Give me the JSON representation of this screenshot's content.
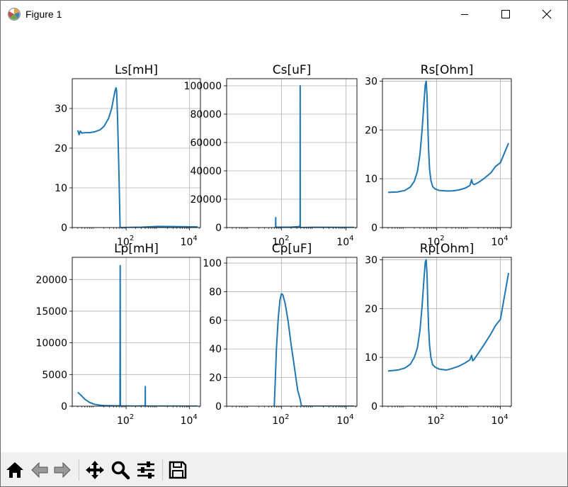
{
  "window": {
    "title": "Figure 1",
    "icons": [
      "app-icon",
      "minimize-icon",
      "maximize-icon",
      "close-icon"
    ]
  },
  "toolbar": {
    "buttons": [
      {
        "name": "home-button",
        "icon": "home-icon"
      },
      {
        "name": "back-button",
        "icon": "back-arrow-icon"
      },
      {
        "name": "forward-button",
        "icon": "forward-arrow-icon"
      },
      {
        "name": "pan-button",
        "icon": "pan-icon"
      },
      {
        "name": "zoom-button",
        "icon": "zoom-icon"
      },
      {
        "name": "subplots-button",
        "icon": "sliders-icon"
      },
      {
        "name": "save-button",
        "icon": "save-icon"
      }
    ]
  },
  "colors": {
    "line": "#1f77b4",
    "grid": "#b0b0b0",
    "toolbar_bg": "#f0f0f0"
  },
  "chart_data": [
    {
      "type": "line",
      "title": "Ls[mH]",
      "xscale": "log",
      "xlim": [
        2,
        22000
      ],
      "ylim": [
        0,
        37.5
      ],
      "yticks": [
        0,
        10,
        20,
        30
      ],
      "ytick_labels": [
        "0",
        "10",
        "20",
        "30"
      ],
      "xticks": [
        100,
        10000
      ],
      "xtick_labels": [
        "10^2",
        "10^4"
      ],
      "grid": true,
      "series": [
        {
          "x": [
            3,
            3.3,
            3.6,
            4,
            5,
            7,
            10,
            15,
            20,
            28,
            35,
            40,
            45,
            48,
            50,
            52,
            54,
            56,
            60,
            63,
            64.5,
            67,
            300,
            1000,
            3000,
            8000,
            18000
          ],
          "y": [
            24.5,
            23.4,
            24.3,
            23.8,
            23.9,
            23.9,
            24.1,
            24.6,
            25.5,
            27.5,
            30,
            32.5,
            34.5,
            35.2,
            34.5,
            31,
            27,
            22,
            12,
            4,
            0,
            0,
            0.1,
            0.3,
            0.25,
            0.2,
            0.15
          ]
        }
      ]
    },
    {
      "type": "line",
      "title": "Cs[uF]",
      "xscale": "log",
      "xlim": [
        2,
        22000
      ],
      "ylim": [
        0,
        105000
      ],
      "yticks": [
        0,
        20000,
        40000,
        60000,
        80000,
        100000
      ],
      "ytick_labels": [
        "0",
        "20000",
        "40000",
        "60000",
        "80000",
        "100000"
      ],
      "xticks": [
        100,
        10000
      ],
      "xtick_labels": [
        "10^2",
        "10^4"
      ],
      "grid": true,
      "series": [
        {
          "x": [
            66,
            66.5,
            67,
            68,
            100,
            200,
            350,
            380,
            382,
            384,
            1000,
            5000,
            18000
          ],
          "y": [
            0,
            7000,
            0,
            300,
            250,
            300,
            600,
            1500,
            100000,
            0,
            200,
            150,
            100
          ]
        }
      ]
    },
    {
      "type": "line",
      "title": "Rs[Ohm]",
      "xscale": "log",
      "xlim": [
        2,
        22000
      ],
      "ylim": [
        0,
        30.5
      ],
      "yticks": [
        0,
        10,
        20,
        30
      ],
      "ytick_labels": [
        "0",
        "10",
        "20",
        "30"
      ],
      "xticks": [
        100,
        10000
      ],
      "xtick_labels": [
        "10^2",
        "10^4"
      ],
      "grid": true,
      "series": [
        {
          "x": [
            3,
            6,
            10,
            15,
            20,
            25,
            30,
            35,
            40,
            44,
            47,
            50,
            53,
            56,
            60,
            66,
            75,
            90,
            120,
            200,
            300,
            500,
            800,
            1100,
            1250,
            1350,
            1500,
            2000,
            3000,
            5000,
            7000,
            10000,
            18000
          ],
          "y": [
            7.2,
            7.3,
            7.6,
            8.3,
            9.5,
            11.5,
            15,
            20,
            25.5,
            29.2,
            30,
            27,
            21,
            16,
            12,
            9.7,
            8.4,
            7.9,
            7.6,
            7.5,
            7.5,
            7.7,
            8.1,
            8.6,
            9.8,
            9,
            8.8,
            9.2,
            10,
            11.2,
            12.5,
            13.3,
            17.3
          ]
        }
      ]
    },
    {
      "type": "line",
      "title": "Lp[mH]",
      "xscale": "log",
      "xlim": [
        2,
        22000
      ],
      "ylim": [
        0,
        23500
      ],
      "yticks": [
        0,
        5000,
        10000,
        15000,
        20000
      ],
      "ytick_labels": [
        "0",
        "5000",
        "10000",
        "15000",
        "20000"
      ],
      "xticks": [
        100,
        10000
      ],
      "xtick_labels": [
        "10^2",
        "10^4"
      ],
      "grid": true,
      "series": [
        {
          "x": [
            3,
            4,
            5,
            7,
            10,
            15,
            20,
            30,
            50,
            64,
            65,
            66,
            70,
            200,
            400,
            402,
            404,
            1000,
            5000,
            18000
          ],
          "y": [
            2200,
            1600,
            1100,
            600,
            300,
            150,
            100,
            80,
            60,
            50,
            22200,
            0,
            40,
            20,
            50,
            3100,
            30,
            20,
            10,
            5
          ]
        }
      ]
    },
    {
      "type": "line",
      "title": "Cp[uF]",
      "xscale": "log",
      "xlim": [
        2,
        22000
      ],
      "ylim": [
        0,
        104
      ],
      "yticks": [
        0,
        20,
        40,
        60,
        80,
        100
      ],
      "ytick_labels": [
        "0",
        "20",
        "40",
        "60",
        "80",
        "100"
      ],
      "xticks": [
        100,
        10000
      ],
      "xtick_labels": [
        "10^2",
        "10^4"
      ],
      "grid": true,
      "series": [
        {
          "x": [
            60,
            65,
            70,
            80,
            90,
            100,
            110,
            130,
            160,
            200,
            250,
            320,
            380,
            420,
            17000,
            18000
          ],
          "y": [
            0,
            20,
            40,
            62,
            74,
            78.5,
            78,
            72,
            60,
            43,
            28,
            11,
            5,
            0,
            0,
            0
          ]
        }
      ]
    },
    {
      "type": "line",
      "title": "Rp[Ohm]",
      "xscale": "log",
      "xlim": [
        2,
        22000
      ],
      "ylim": [
        0,
        30.5
      ],
      "yticks": [
        0,
        10,
        20,
        30
      ],
      "ytick_labels": [
        "0",
        "10",
        "20",
        "30"
      ],
      "xticks": [
        100,
        10000
      ],
      "xtick_labels": [
        "10^2",
        "10^4"
      ],
      "grid": true,
      "series": [
        {
          "x": [
            3,
            6,
            10,
            15,
            20,
            25,
            30,
            35,
            40,
            44,
            47,
            50,
            53,
            56,
            60,
            66,
            75,
            90,
            120,
            200,
            300,
            500,
            800,
            1100,
            1250,
            1350,
            1500,
            2000,
            3000,
            5000,
            7000,
            10000,
            18000
          ],
          "y": [
            7.2,
            7.4,
            7.8,
            8.6,
            10,
            12,
            15.5,
            20.5,
            26,
            29.5,
            30,
            27,
            21,
            16,
            12.5,
            10,
            8.5,
            8,
            7.6,
            7.4,
            7.7,
            8.2,
            8.9,
            9.5,
            10.4,
            9.3,
            9.6,
            10.8,
            12.5,
            14.8,
            16.5,
            17.8,
            27.3
          ]
        }
      ]
    }
  ]
}
